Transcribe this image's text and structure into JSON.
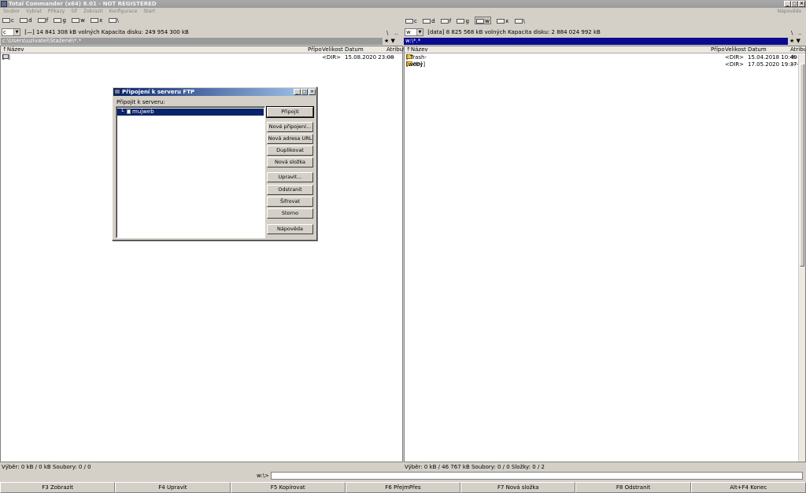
{
  "window": {
    "title": "Total Commander (x64) 8.01 - NOT REGISTERED",
    "min": "_",
    "max": "□",
    "close": "×"
  },
  "menu": {
    "items": [
      "Soubor",
      "Vybrat",
      "Příkazy",
      "Síť",
      "Zobrazit",
      "Konfigurace",
      "Start"
    ],
    "help": "Nápověda"
  },
  "left": {
    "drives": [
      "c",
      "d",
      "f",
      "g",
      "w",
      "x",
      "\\"
    ],
    "active_drive": "c",
    "combo": "c",
    "volume": "[—]",
    "info": "14 841 308 kB volných  Kapacita disku: 249 954 300 kB",
    "root_btn": "\\",
    "parent_btn": "..",
    "path": "c:\\Users\\uzivatel\\Stažené\\*.*",
    "columns": [
      "Název",
      "Přípo",
      "Velikost",
      "Datum",
      "Atribut"
    ],
    "files": [
      {
        "name": "[..]",
        "size": "<DIR>",
        "date": "15.08.2020 23:08",
        "attr": "----"
      }
    ],
    "status": "Výběr: 0 kB / 0 kB  Soubory: 0 / 0"
  },
  "right": {
    "drives": [
      "c",
      "d",
      "f",
      "g",
      "w",
      "x",
      "\\"
    ],
    "active_drive": "w",
    "combo": "w",
    "volume": "[data]",
    "info": "8 825 568 kB volných  Kapacita disku: 2 884 024 992 kB",
    "root_btn": "\\",
    "parent_btn": "..",
    "path": "w:\\*.*",
    "columns": [
      "Název",
      "Přípo",
      "Velikost",
      "Datum",
      "Atribut"
    ],
    "files": [
      {
        "name": "[.Trash-1000]",
        "size": "<DIR>",
        "date": "15.04.2018 10:40",
        "attr": "-h-"
      },
      {
        "name": "[weby]",
        "size": "<DIR>",
        "date": "17.05.2020 19:37",
        "attr": "----"
      }
    ],
    "status": "Výběr: 0 kB / 46 767 kB  Soubory: 0 / 0  Složky: 0 / 2"
  },
  "cmdline": {
    "label": "w:\\>",
    "value": ""
  },
  "fkeys": [
    "F3 Zobrazit",
    "F4 Upravit",
    "F5 Kopírovat",
    "F6 PřejmPřes",
    "F7 Nová složka",
    "F8 Odstranit",
    "Alt+F4 Konec"
  ],
  "dialog": {
    "title": "Připojení k serveru FTP",
    "label": "Připojit k serveru:",
    "server": "mujweb",
    "tree": "└",
    "buttons": {
      "connect": "Připojit",
      "new_connection": "Nové připojení...",
      "new_url": "Nová adresa URL",
      "duplicate": "Duplikovat",
      "new_folder": "Nová složka",
      "edit": "Upravit...",
      "delete": "Odstranit",
      "encrypt": "Šifrovat",
      "cancel": "Storno",
      "help": "Nápověda"
    }
  }
}
